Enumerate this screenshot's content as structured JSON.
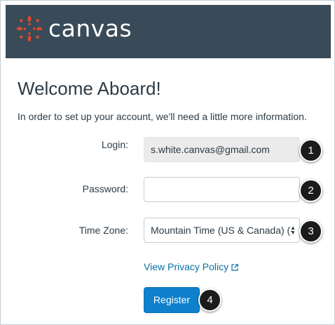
{
  "header": {
    "brand": "canvas",
    "logo_icon": "canvas-logo-icon",
    "background": "#394b58",
    "accent": "#e0482b"
  },
  "page": {
    "title": "Welcome Aboard!",
    "intro": "In order to set up your account, we'll need a little more information."
  },
  "form": {
    "login": {
      "label": "Login:",
      "value": "s.white.canvas@gmail.com",
      "badge": "1"
    },
    "password": {
      "label": "Password:",
      "value": "",
      "badge": "2"
    },
    "timezone": {
      "label": "Time Zone:",
      "value": "Mountain Time (US & Canada) (-",
      "badge": "3"
    },
    "privacy_link": {
      "label": "View Privacy Policy",
      "icon": "external-link-icon"
    },
    "register": {
      "label": "Register",
      "badge": "4"
    }
  }
}
